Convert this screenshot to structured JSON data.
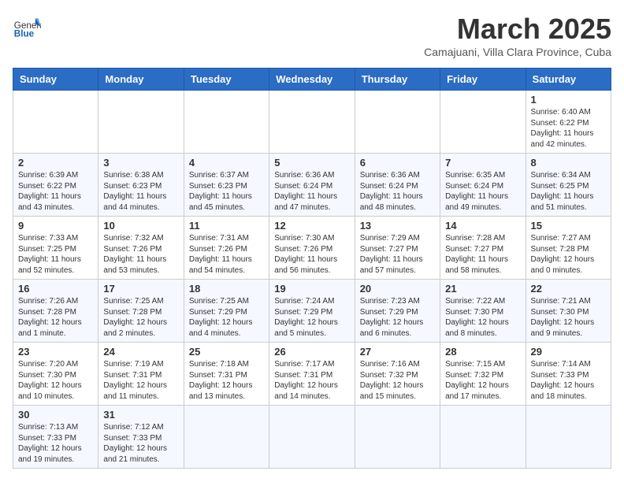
{
  "header": {
    "logo_general": "General",
    "logo_blue": "Blue",
    "month_title": "March 2025",
    "subtitle": "Camajuani, Villa Clara Province, Cuba"
  },
  "days_of_week": [
    "Sunday",
    "Monday",
    "Tuesday",
    "Wednesday",
    "Thursday",
    "Friday",
    "Saturday"
  ],
  "weeks": [
    [
      {
        "day": "",
        "info": ""
      },
      {
        "day": "",
        "info": ""
      },
      {
        "day": "",
        "info": ""
      },
      {
        "day": "",
        "info": ""
      },
      {
        "day": "",
        "info": ""
      },
      {
        "day": "",
        "info": ""
      },
      {
        "day": "1",
        "info": "Sunrise: 6:40 AM\nSunset: 6:22 PM\nDaylight: 11 hours\nand 42 minutes."
      }
    ],
    [
      {
        "day": "2",
        "info": "Sunrise: 6:39 AM\nSunset: 6:22 PM\nDaylight: 11 hours\nand 43 minutes."
      },
      {
        "day": "3",
        "info": "Sunrise: 6:38 AM\nSunset: 6:23 PM\nDaylight: 11 hours\nand 44 minutes."
      },
      {
        "day": "4",
        "info": "Sunrise: 6:37 AM\nSunset: 6:23 PM\nDaylight: 11 hours\nand 45 minutes."
      },
      {
        "day": "5",
        "info": "Sunrise: 6:36 AM\nSunset: 6:24 PM\nDaylight: 11 hours\nand 47 minutes."
      },
      {
        "day": "6",
        "info": "Sunrise: 6:36 AM\nSunset: 6:24 PM\nDaylight: 11 hours\nand 48 minutes."
      },
      {
        "day": "7",
        "info": "Sunrise: 6:35 AM\nSunset: 6:24 PM\nDaylight: 11 hours\nand 49 minutes."
      },
      {
        "day": "8",
        "info": "Sunrise: 6:34 AM\nSunset: 6:25 PM\nDaylight: 11 hours\nand 51 minutes."
      }
    ],
    [
      {
        "day": "9",
        "info": "Sunrise: 7:33 AM\nSunset: 7:25 PM\nDaylight: 11 hours\nand 52 minutes."
      },
      {
        "day": "10",
        "info": "Sunrise: 7:32 AM\nSunset: 7:26 PM\nDaylight: 11 hours\nand 53 minutes."
      },
      {
        "day": "11",
        "info": "Sunrise: 7:31 AM\nSunset: 7:26 PM\nDaylight: 11 hours\nand 54 minutes."
      },
      {
        "day": "12",
        "info": "Sunrise: 7:30 AM\nSunset: 7:26 PM\nDaylight: 11 hours\nand 56 minutes."
      },
      {
        "day": "13",
        "info": "Sunrise: 7:29 AM\nSunset: 7:27 PM\nDaylight: 11 hours\nand 57 minutes."
      },
      {
        "day": "14",
        "info": "Sunrise: 7:28 AM\nSunset: 7:27 PM\nDaylight: 11 hours\nand 58 minutes."
      },
      {
        "day": "15",
        "info": "Sunrise: 7:27 AM\nSunset: 7:28 PM\nDaylight: 12 hours\nand 0 minutes."
      }
    ],
    [
      {
        "day": "16",
        "info": "Sunrise: 7:26 AM\nSunset: 7:28 PM\nDaylight: 12 hours\nand 1 minute."
      },
      {
        "day": "17",
        "info": "Sunrise: 7:25 AM\nSunset: 7:28 PM\nDaylight: 12 hours\nand 2 minutes."
      },
      {
        "day": "18",
        "info": "Sunrise: 7:25 AM\nSunset: 7:29 PM\nDaylight: 12 hours\nand 4 minutes."
      },
      {
        "day": "19",
        "info": "Sunrise: 7:24 AM\nSunset: 7:29 PM\nDaylight: 12 hours\nand 5 minutes."
      },
      {
        "day": "20",
        "info": "Sunrise: 7:23 AM\nSunset: 7:29 PM\nDaylight: 12 hours\nand 6 minutes."
      },
      {
        "day": "21",
        "info": "Sunrise: 7:22 AM\nSunset: 7:30 PM\nDaylight: 12 hours\nand 8 minutes."
      },
      {
        "day": "22",
        "info": "Sunrise: 7:21 AM\nSunset: 7:30 PM\nDaylight: 12 hours\nand 9 minutes."
      }
    ],
    [
      {
        "day": "23",
        "info": "Sunrise: 7:20 AM\nSunset: 7:30 PM\nDaylight: 12 hours\nand 10 minutes."
      },
      {
        "day": "24",
        "info": "Sunrise: 7:19 AM\nSunset: 7:31 PM\nDaylight: 12 hours\nand 11 minutes."
      },
      {
        "day": "25",
        "info": "Sunrise: 7:18 AM\nSunset: 7:31 PM\nDaylight: 12 hours\nand 13 minutes."
      },
      {
        "day": "26",
        "info": "Sunrise: 7:17 AM\nSunset: 7:31 PM\nDaylight: 12 hours\nand 14 minutes."
      },
      {
        "day": "27",
        "info": "Sunrise: 7:16 AM\nSunset: 7:32 PM\nDaylight: 12 hours\nand 15 minutes."
      },
      {
        "day": "28",
        "info": "Sunrise: 7:15 AM\nSunset: 7:32 PM\nDaylight: 12 hours\nand 17 minutes."
      },
      {
        "day": "29",
        "info": "Sunrise: 7:14 AM\nSunset: 7:33 PM\nDaylight: 12 hours\nand 18 minutes."
      }
    ],
    [
      {
        "day": "30",
        "info": "Sunrise: 7:13 AM\nSunset: 7:33 PM\nDaylight: 12 hours\nand 19 minutes."
      },
      {
        "day": "31",
        "info": "Sunrise: 7:12 AM\nSunset: 7:33 PM\nDaylight: 12 hours\nand 21 minutes."
      },
      {
        "day": "",
        "info": ""
      },
      {
        "day": "",
        "info": ""
      },
      {
        "day": "",
        "info": ""
      },
      {
        "day": "",
        "info": ""
      },
      {
        "day": "",
        "info": ""
      }
    ]
  ]
}
